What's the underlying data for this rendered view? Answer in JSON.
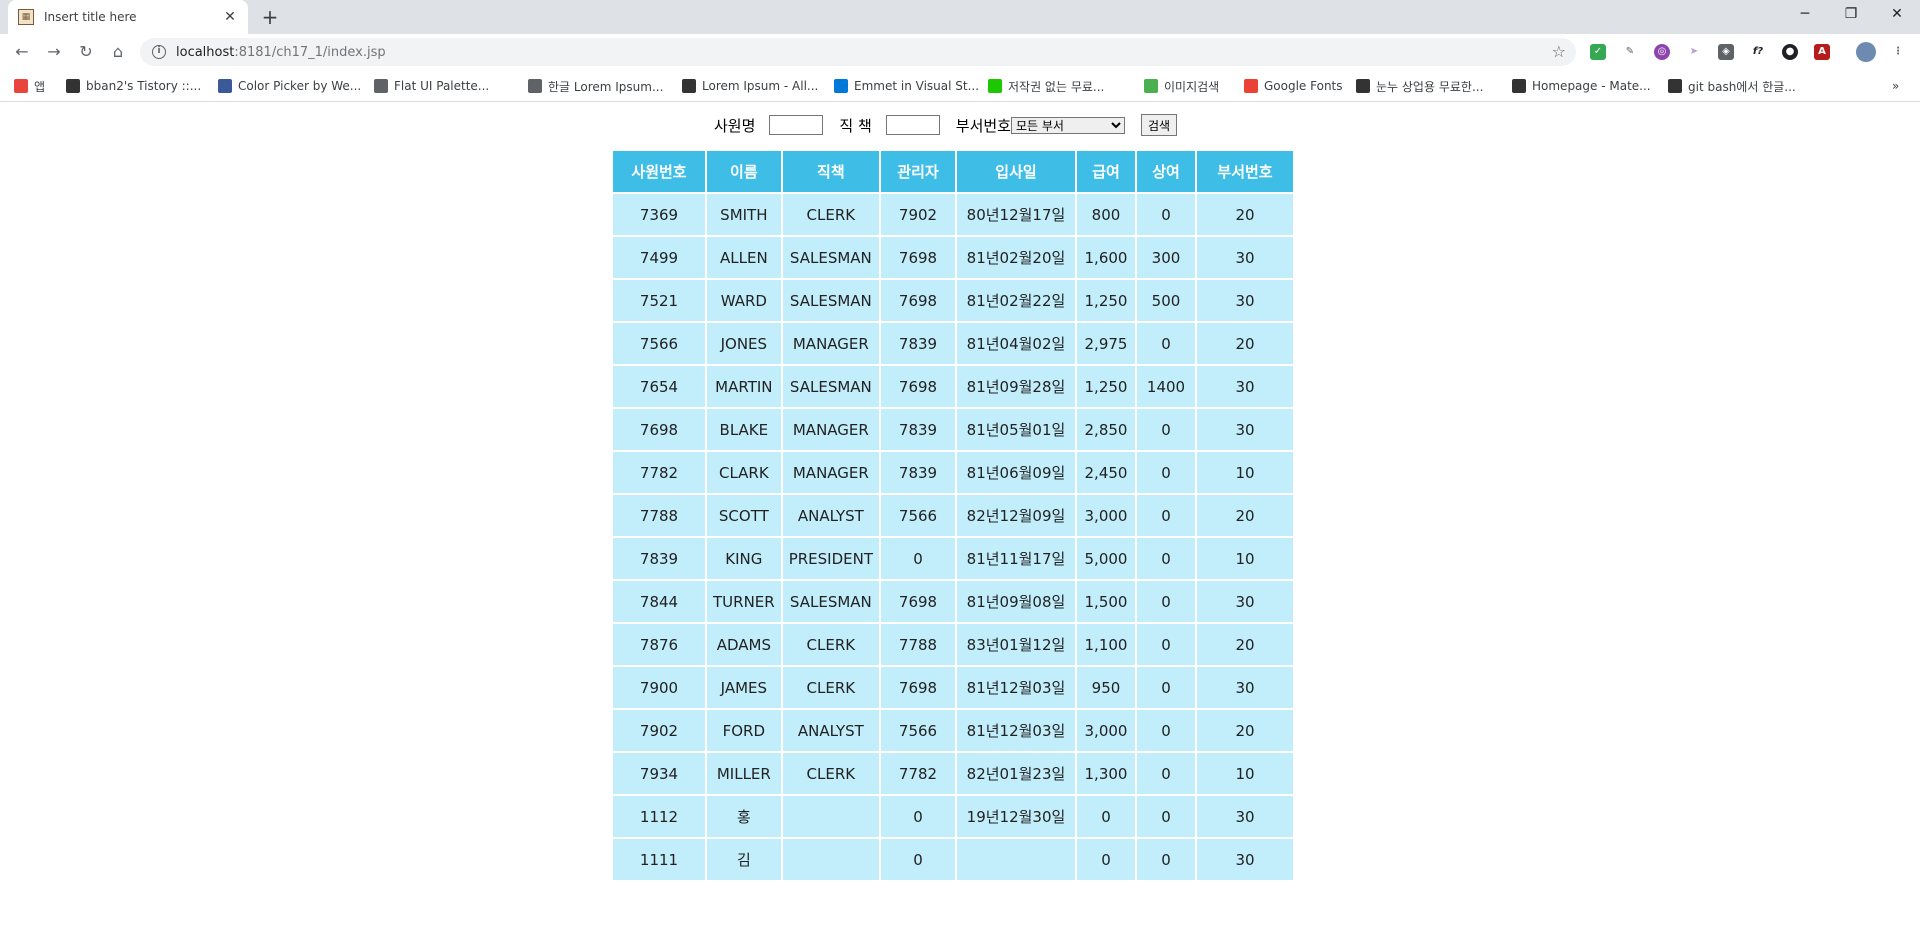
{
  "browser": {
    "tab_title": "Insert title here",
    "url_host": "localhost",
    "url_path": ":8181/ch17_1/index.jsp",
    "bookmarks": [
      {
        "label": "앱",
        "icon": "apps-icon",
        "color": "#e8453c"
      },
      {
        "label": "bban2's Tistory ::...",
        "icon": "tistory-icon",
        "color": "#333333"
      },
      {
        "label": "Color Picker by We...",
        "icon": "fx-icon",
        "color": "#3b5998"
      },
      {
        "label": "Flat UI Palette...",
        "icon": "globe-icon",
        "color": "#5f6368"
      },
      {
        "label": "한글 Lorem Ipsum...",
        "icon": "globe-icon",
        "color": "#5f6368"
      },
      {
        "label": "Lorem Ipsum - All...",
        "icon": "lorem-icon",
        "color": "#333333"
      },
      {
        "label": "Emmet in Visual St...",
        "icon": "vscode-icon",
        "color": "#0078d7"
      },
      {
        "label": "저작권 없는 무료...",
        "icon": "chat-icon",
        "color": "#1ec800"
      },
      {
        "label": "이미지검색",
        "icon": "px-icon",
        "color": "#4caf50"
      },
      {
        "label": "Google Fonts",
        "icon": "fonts-icon",
        "color": "#ea4335"
      },
      {
        "label": "눈누 상업용 무료한...",
        "icon": "noonnu-icon",
        "color": "#333333"
      },
      {
        "label": "Homepage - Mate...",
        "icon": "github-icon",
        "color": "#333333"
      },
      {
        "label": "git bash에서 한글...",
        "icon": "tistory-icon",
        "color": "#333333"
      }
    ]
  },
  "search": {
    "name_label": "사원명",
    "job_label": "직 책",
    "dept_label": "부서번호",
    "dept_selected": "모든 부서",
    "search_button": "검색"
  },
  "table": {
    "headers": [
      "사원번호",
      "이름",
      "직책",
      "관리자",
      "입사일",
      "급여",
      "상여",
      "부서번호"
    ],
    "rows": [
      [
        "7369",
        "SMITH",
        "CLERK",
        "7902",
        "80년12월17일",
        "800",
        "0",
        "20"
      ],
      [
        "7499",
        "ALLEN",
        "SALESMAN",
        "7698",
        "81년02월20일",
        "1,600",
        "300",
        "30"
      ],
      [
        "7521",
        "WARD",
        "SALESMAN",
        "7698",
        "81년02월22일",
        "1,250",
        "500",
        "30"
      ],
      [
        "7566",
        "JONES",
        "MANAGER",
        "7839",
        "81년04월02일",
        "2,975",
        "0",
        "20"
      ],
      [
        "7654",
        "MARTIN",
        "SALESMAN",
        "7698",
        "81년09월28일",
        "1,250",
        "1400",
        "30"
      ],
      [
        "7698",
        "BLAKE",
        "MANAGER",
        "7839",
        "81년05월01일",
        "2,850",
        "0",
        "30"
      ],
      [
        "7782",
        "CLARK",
        "MANAGER",
        "7839",
        "81년06월09일",
        "2,450",
        "0",
        "10"
      ],
      [
        "7788",
        "SCOTT",
        "ANALYST",
        "7566",
        "82년12월09일",
        "3,000",
        "0",
        "20"
      ],
      [
        "7839",
        "KING",
        "PRESIDENT",
        "0",
        "81년11월17일",
        "5,000",
        "0",
        "10"
      ],
      [
        "7844",
        "TURNER",
        "SALESMAN",
        "7698",
        "81년09월08일",
        "1,500",
        "0",
        "30"
      ],
      [
        "7876",
        "ADAMS",
        "CLERK",
        "7788",
        "83년01월12일",
        "1,100",
        "0",
        "20"
      ],
      [
        "7900",
        "JAMES",
        "CLERK",
        "7698",
        "81년12월03일",
        "950",
        "0",
        "30"
      ],
      [
        "7902",
        "FORD",
        "ANALYST",
        "7566",
        "81년12월03일",
        "3,000",
        "0",
        "20"
      ],
      [
        "7934",
        "MILLER",
        "CLERK",
        "7782",
        "82년01월23일",
        "1,300",
        "0",
        "10"
      ],
      [
        "1112",
        "홍",
        "",
        "0",
        "19년12월30일",
        "0",
        "0",
        "30"
      ],
      [
        "1111",
        "김",
        "",
        "0",
        "",
        "0",
        "0",
        "30"
      ]
    ]
  }
}
